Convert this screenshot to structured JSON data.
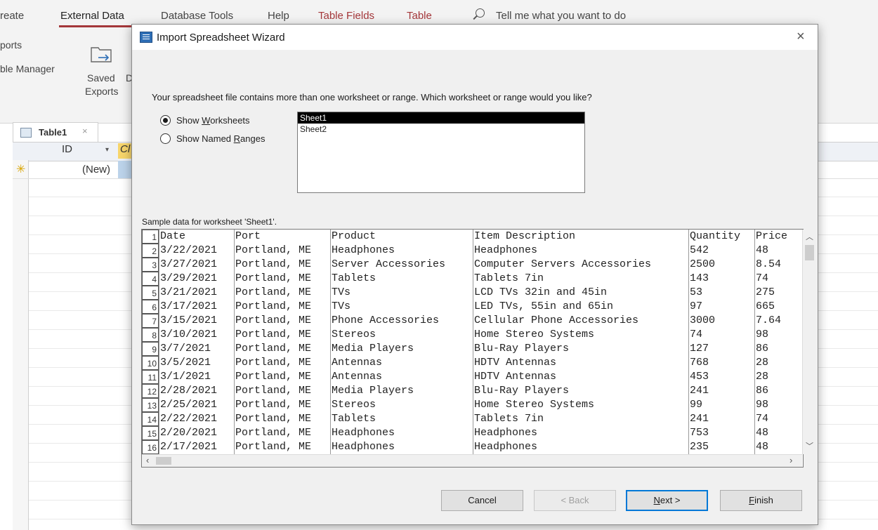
{
  "ribbon": {
    "tabs": [
      "reate",
      "External Data",
      "Database Tools",
      "Help",
      "Table Fields",
      "Table"
    ],
    "tellme": "Tell me what you want to do",
    "left_items": [
      "ports",
      "ble Manager"
    ],
    "saved_exports": [
      "Saved",
      "Exports"
    ],
    "clipped_letter": "D"
  },
  "document": {
    "tab_label": "Table1",
    "tab_close": "×",
    "columns": {
      "id": "ID",
      "second": "Cl"
    },
    "new_row_label": "(New)"
  },
  "dialog": {
    "title": "Import Spreadsheet Wizard",
    "close_glyph": "×",
    "prompt": "Your spreadsheet file contains more than one worksheet or range. Which worksheet or range would you like?",
    "options": [
      {
        "label_pre": "Show ",
        "label_key": "W",
        "label_post": "orksheets",
        "checked": true
      },
      {
        "label_pre": "Show Named ",
        "label_key": "R",
        "label_post": "anges",
        "checked": false
      }
    ],
    "sheets": [
      "Sheet1",
      "Sheet2"
    ],
    "selected_sheet": "Sheet1",
    "sample_label": "Sample data for worksheet 'Sheet1'.",
    "sample_rows": [
      [
        "1",
        "Date",
        "Port",
        "Product",
        "Item Description",
        "Quantity",
        "Price"
      ],
      [
        "2",
        "3/22/2021",
        "Portland, ME",
        "Headphones",
        "Headphones",
        "542",
        "48"
      ],
      [
        "3",
        "3/27/2021",
        "Portland, ME",
        "Server Accessories",
        "Computer Servers Accessories",
        "2500",
        "8.54"
      ],
      [
        "4",
        "3/29/2021",
        "Portland, ME",
        "Tablets",
        "Tablets 7in",
        "143",
        "74"
      ],
      [
        "5",
        "3/21/2021",
        "Portland, ME",
        "TVs",
        "LCD TVs 32in and 45in",
        "53",
        "275"
      ],
      [
        "6",
        "3/17/2021",
        "Portland, ME",
        "TVs",
        "LED TVs, 55in and 65in",
        "97",
        "665"
      ],
      [
        "7",
        "3/15/2021",
        "Portland, ME",
        "Phone Accessories",
        "Cellular Phone Accessories",
        "3000",
        "7.64"
      ],
      [
        "8",
        "3/10/2021",
        "Portland, ME",
        "Stereos",
        "Home Stereo Systems",
        "74",
        "98"
      ],
      [
        "9",
        "3/7/2021",
        "Portland, ME",
        "Media Players",
        "Blu-Ray Players",
        "127",
        "86"
      ],
      [
        "10",
        "3/5/2021",
        "Portland, ME",
        "Antennas",
        "HDTV Antennas",
        "768",
        "28"
      ],
      [
        "11",
        "3/1/2021",
        "Portland, ME",
        "Antennas",
        "HDTV Antennas",
        "453",
        "28"
      ],
      [
        "12",
        "2/28/2021",
        "Portland, ME",
        "Media Players",
        "Blu-Ray Players",
        "241",
        "86"
      ],
      [
        "13",
        "2/25/2021",
        "Portland, ME",
        "Stereos",
        "Home Stereo Systems",
        "99",
        "98"
      ],
      [
        "14",
        "2/22/2021",
        "Portland, ME",
        "Tablets",
        "Tablets 7in",
        "241",
        "74"
      ],
      [
        "15",
        "2/20/2021",
        "Portland, ME",
        "Headphones",
        "Headphones",
        "753",
        "48"
      ],
      [
        "16",
        "2/17/2021",
        "Portland, ME",
        "Headphones",
        "Headphones",
        "235",
        "48"
      ]
    ],
    "buttons": {
      "cancel": "Cancel",
      "back": "< Back",
      "next_key": "N",
      "next_rest": "ext >",
      "finish_key": "F",
      "finish_rest": "inish"
    }
  },
  "colors": {
    "accent_red": "#a4373a",
    "selection": "#000000",
    "default_button_border": "#0078d7"
  }
}
